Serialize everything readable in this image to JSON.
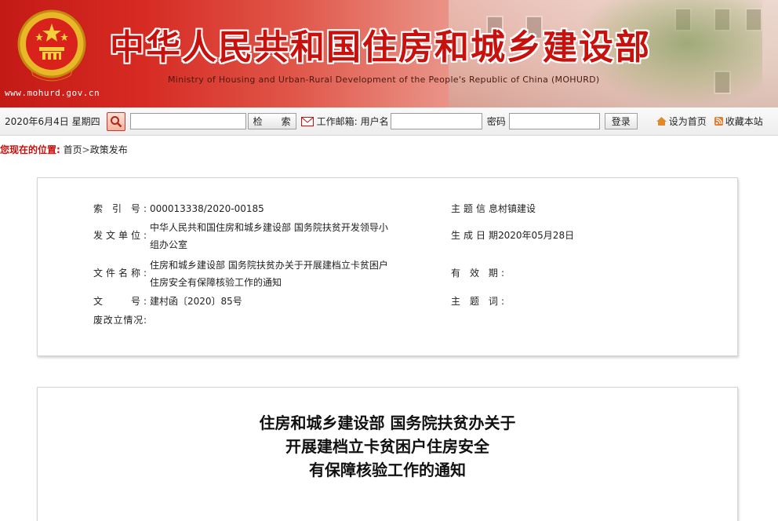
{
  "header": {
    "url": "www.mohurd.gov.cn",
    "title": "中华人民共和国住房和城乡建设部",
    "subtitle": "Ministry of Housing and Urban-Rural Development of the People's Republic of China (MOHURD)",
    "brand_color": "#c8100d"
  },
  "toolbar": {
    "date": "2020年6月4日 星期四",
    "search_placeholder": "",
    "search_button": "检　　索",
    "mail_label": "工作邮箱:",
    "username_label": "用户名",
    "password_label": "密码",
    "login_button": "登录",
    "set_home": "设为首页",
    "bookmark": "收藏本站"
  },
  "breadcrumb": {
    "label": "您现在的位置:",
    "home": "首页",
    "separator": ">",
    "current": "政策发布"
  },
  "info": {
    "index_label": "索 引 号:",
    "index_value": "000013338/2020-00185",
    "issuer_label": "发文单位:",
    "issuer_value_line1": "中华人民共和国住房和城乡建设部 国务院扶贫开发领导小",
    "issuer_value_line2": "组办公室",
    "docname_label": "文件名称:",
    "docname_value_line1": "住房和城乡建设部 国务院扶贫办关于开展建档立卡贫困户",
    "docname_value_line2": "住房安全有保障核验工作的通知",
    "docno_label": "文　　号:",
    "docno_value": "建村函〔2020〕85号",
    "status_label": "废改立情况:",
    "status_value": "",
    "topic_label": "主题信息:",
    "topic_value": "村镇建设",
    "date_label": "生成日期:",
    "date_value": "2020年05月28日",
    "valid_label": "有 效 期:",
    "valid_value": "",
    "keyword_label": "主 题 词:",
    "keyword_value": ""
  },
  "article": {
    "title_line1": "住房和城乡建设部 国务院扶贫办关于",
    "title_line2": "开展建档立卡贫困户住房安全",
    "title_line3": "有保障核验工作的通知"
  }
}
